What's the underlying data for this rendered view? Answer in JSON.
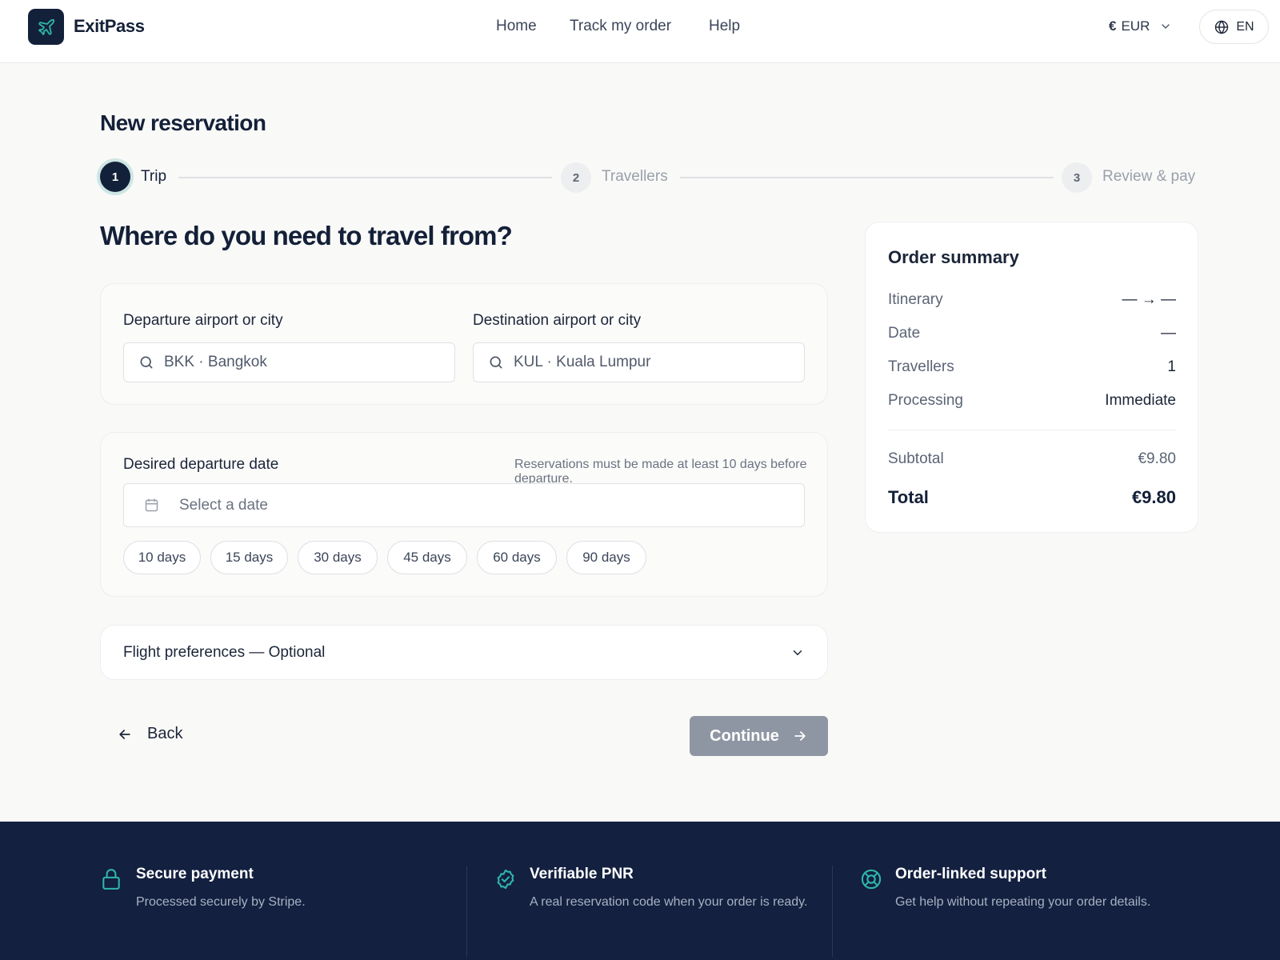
{
  "header": {
    "brand": "ExitPass",
    "nav": [
      "Home",
      "Track my order",
      "Help"
    ],
    "currency": "EUR",
    "currency_symbol": "€",
    "language": "EN"
  },
  "page": {
    "title": "New reservation",
    "question": "Where do you need to travel from?"
  },
  "stepper": [
    {
      "number": "1",
      "label": "Trip",
      "state": "active"
    },
    {
      "number": "2",
      "label": "Travellers",
      "state": "upcoming"
    },
    {
      "number": "3",
      "label": "Review & pay",
      "state": "upcoming"
    }
  ],
  "airports": {
    "departure_label": "Departure airport or city",
    "departure_value": "BKK · Bangkok",
    "destination_label": "Destination airport or city",
    "destination_value": "KUL · Kuala Lumpur"
  },
  "date": {
    "label": "Desired departure date",
    "note": "Reservations must be made at least 10 days before departure.",
    "placeholder": "Select a date",
    "chips": [
      "10 days",
      "15 days",
      "30 days",
      "45 days",
      "60 days",
      "90 days"
    ]
  },
  "preferences": {
    "label": "Flight preferences — Optional"
  },
  "actions": {
    "back": "Back",
    "continue": "Continue"
  },
  "summary": {
    "title": "Order summary",
    "rows": [
      {
        "key": "Itinerary",
        "value": "— → —"
      },
      {
        "key": "Date",
        "value": "—"
      },
      {
        "key": "Travellers",
        "value": "1"
      },
      {
        "key": "Processing",
        "value": "Immediate"
      }
    ],
    "subtotal_label": "Subtotal",
    "subtotal_value": "€9.80",
    "total_label": "Total",
    "total_value": "€9.80"
  },
  "footer": [
    {
      "title": "Secure payment",
      "desc": "Processed securely by Stripe.",
      "icon": "lock-icon"
    },
    {
      "title": "Verifiable PNR",
      "desc": "A real reservation code when your order is ready.",
      "icon": "check-badge-icon"
    },
    {
      "title": "Order-linked support",
      "desc": "Get help without repeating your order details.",
      "icon": "lifebuoy-icon"
    }
  ],
  "colors": {
    "navy": "#13203a",
    "accent_teal": "#2fb6a7",
    "disabled_button": "#8f96a3",
    "footer_bg": "#132040"
  }
}
